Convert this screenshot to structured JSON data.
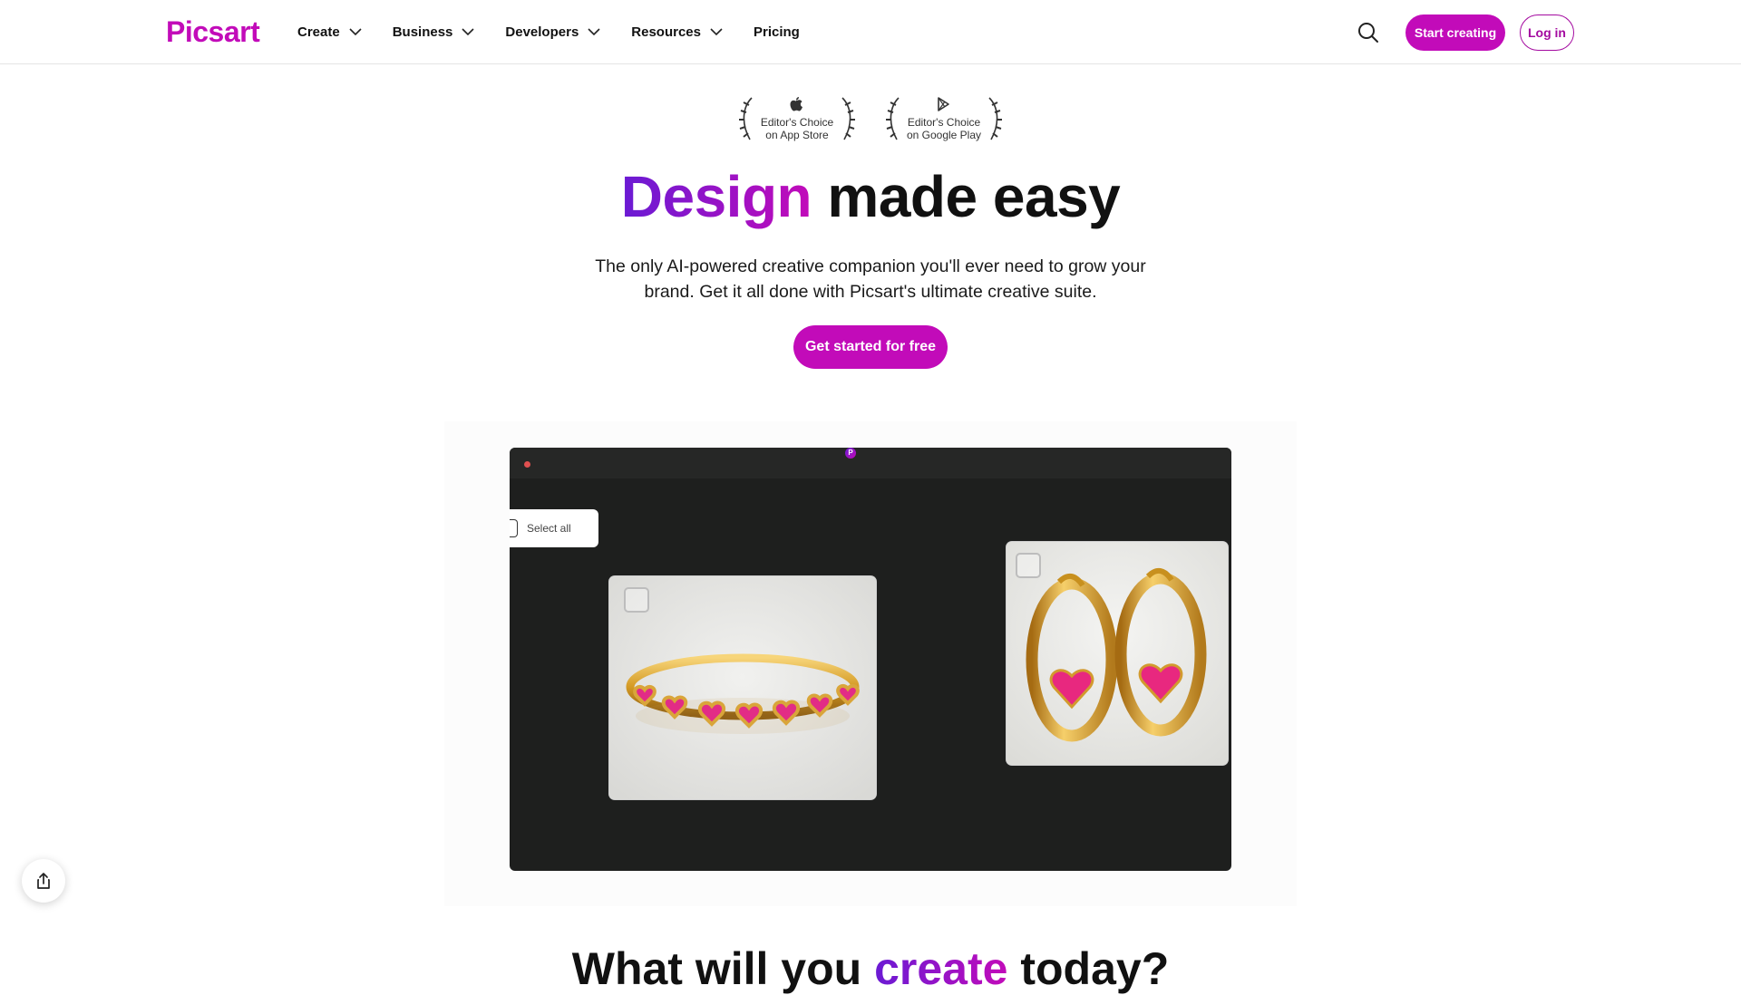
{
  "nav": {
    "logo": "Picsart",
    "menu": [
      {
        "label": "Create",
        "dropdown": true
      },
      {
        "label": "Business",
        "dropdown": true
      },
      {
        "label": "Developers",
        "dropdown": true
      },
      {
        "label": "Resources",
        "dropdown": true
      },
      {
        "label": "Pricing",
        "dropdown": false
      }
    ],
    "search_icon": "search-icon",
    "start_label": "Start creating",
    "login_label": "Log in"
  },
  "awards": [
    {
      "line1": "Editor's Choice",
      "line2": "on App Store",
      "icon": "apple-icon"
    },
    {
      "line1": "Editor's Choice",
      "line2": "on Google Play",
      "icon": "google-play-icon"
    }
  ],
  "hero": {
    "title_accent": "Design",
    "title_rest": "made easy",
    "subtitle": "The only AI-powered creative companion you'll ever need to grow your brand. Get it all done with Picsart's ultimate creative suite.",
    "cta_label": "Get started for free"
  },
  "demo": {
    "select_all_label": "Select all",
    "images": [
      "gold-heart-ring",
      "gold-heart-hoop-earrings"
    ]
  },
  "share_icon": "share-icon",
  "section": {
    "title_before": "What will you",
    "title_accent": "create",
    "title_after": "today?"
  },
  "colors": {
    "brand": "#c20bb9",
    "accent_gradient_start": "#6a1bd4",
    "demo_window": "#1e1f1e"
  }
}
